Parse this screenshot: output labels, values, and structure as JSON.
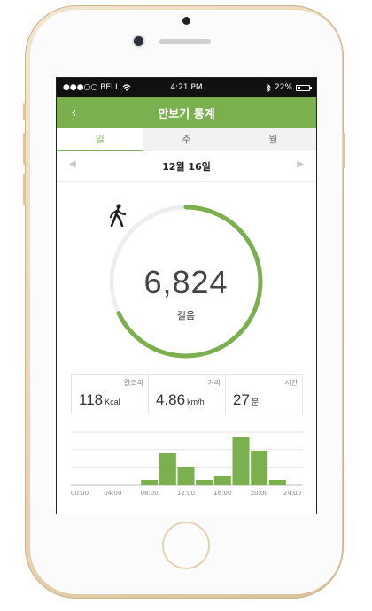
{
  "status_bar": {
    "carrier": "●●●○○ BELL",
    "time": "4:21 PM",
    "battery": "22%"
  },
  "header": {
    "back_icon": "chevron-left-icon",
    "title": "만보기 통계"
  },
  "tabs": [
    {
      "label": "일",
      "active": true
    },
    {
      "label": "주",
      "active": false
    },
    {
      "label": "월",
      "active": false
    }
  ],
  "date_nav": {
    "date": "12월 16일"
  },
  "steps": {
    "value": "6,824",
    "unit": "걸음",
    "progress": 0.68,
    "accent": "#7bb04e"
  },
  "stats": [
    {
      "label": "칼로리",
      "value": "118",
      "unit": "Kcal"
    },
    {
      "label": "거리",
      "value": "4.86",
      "unit": "km/h"
    },
    {
      "label": "시간",
      "value": "27",
      "unit": "분"
    }
  ],
  "chart_data": {
    "type": "bar",
    "categories": [
      "00:00",
      "02:00",
      "04:00",
      "06:00",
      "08:00",
      "10:00",
      "12:00",
      "14:00",
      "16:00",
      "18:00",
      "20:00",
      "22:00",
      "24:00"
    ],
    "tick_labels": [
      "00:00",
      "04:00",
      "08:00",
      "12:00",
      "16:00",
      "20:00",
      "24:00"
    ],
    "values": [
      0,
      0,
      0,
      0,
      1,
      6,
      3.5,
      1,
      1.8,
      9,
      6.5,
      1,
      0
    ],
    "ylim": [
      0,
      10
    ],
    "grid": true,
    "color": "#7bb04e"
  }
}
